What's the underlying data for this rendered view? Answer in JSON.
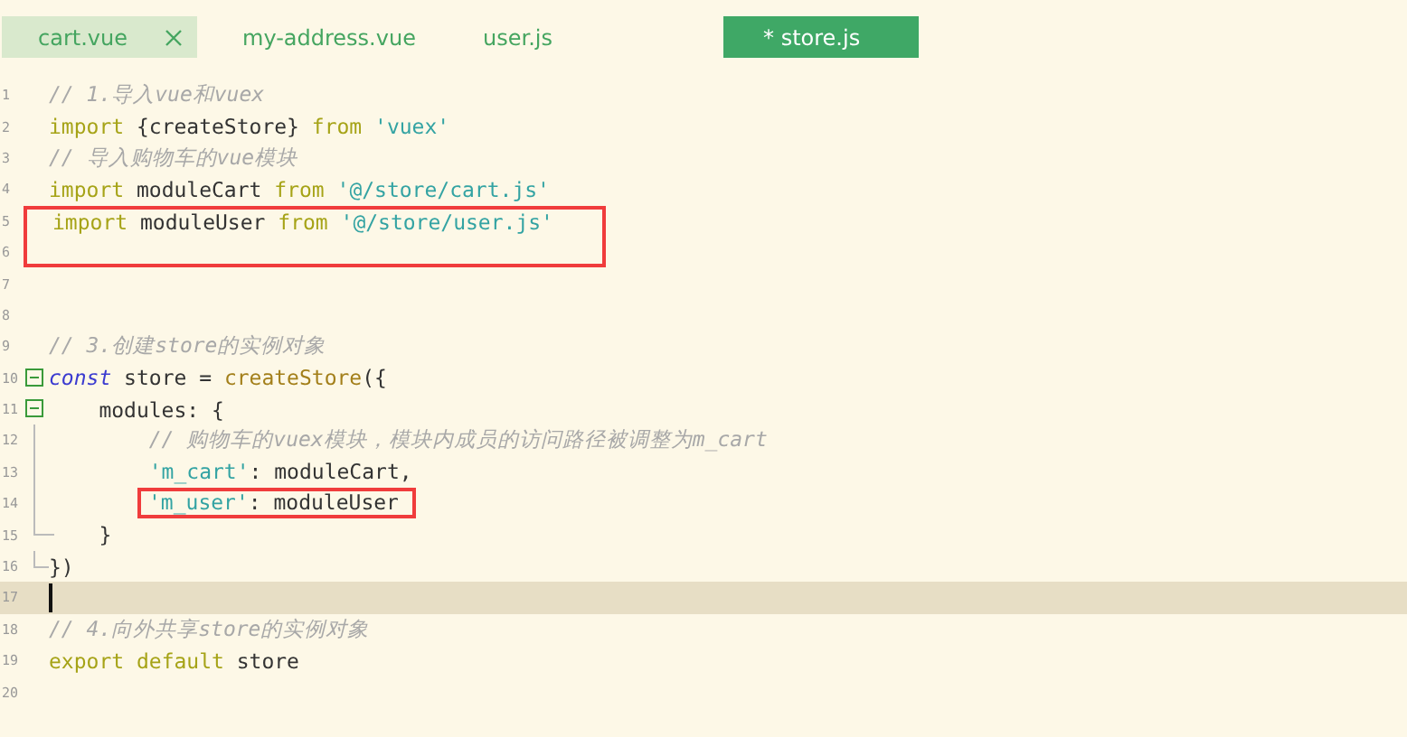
{
  "tabs": [
    {
      "label": "cart.vue",
      "selected": false,
      "hovered": true,
      "closable": true
    },
    {
      "label": "my-address.vue",
      "selected": false,
      "hovered": false,
      "closable": false
    },
    {
      "label": "user.js",
      "selected": false,
      "hovered": false,
      "closable": false
    },
    {
      "label": "* store.js",
      "selected": true,
      "hovered": false,
      "closable": false
    }
  ],
  "lines": [
    {
      "number": "1",
      "kind": "plain",
      "tokens": [
        {
          "kind": "comment",
          "text": "// 1.导入vue和vuex"
        }
      ]
    },
    {
      "number": "2",
      "kind": "plain",
      "tokens": [
        {
          "kind": "keyword",
          "text": "import"
        },
        {
          "kind": "plain",
          "text": " {createStore} "
        },
        {
          "kind": "keyword",
          "text": "from"
        },
        {
          "kind": "string",
          "text": " 'vuex'"
        }
      ]
    },
    {
      "number": "3",
      "kind": "plain",
      "tokens": [
        {
          "kind": "comment",
          "text": "// 导入购物车的vue模块"
        }
      ]
    },
    {
      "number": "4",
      "kind": "plain",
      "tokens": [
        {
          "kind": "keyword",
          "text": "import"
        },
        {
          "kind": "plain",
          "text": " moduleCart "
        },
        {
          "kind": "keyword",
          "text": "from"
        },
        {
          "kind": "string",
          "text": " '@/store/cart.js'"
        }
      ]
    },
    {
      "number": "5",
      "kind": "plain",
      "marked": true,
      "tokens": [
        {
          "kind": "keyword",
          "text": "import"
        },
        {
          "kind": "plain",
          "text": " moduleUser "
        },
        {
          "kind": "keyword",
          "text": "from"
        },
        {
          "kind": "string",
          "text": " '@/store/user.js'"
        }
      ]
    },
    {
      "number": "6",
      "kind": "plain",
      "marked": true
    },
    {
      "number": "7",
      "kind": "plain",
      "marked": false
    },
    {
      "number": "8",
      "kind": "plain"
    },
    {
      "number": "9",
      "kind": "plain",
      "tokens": [
        {
          "kind": "comment",
          "text": "// 3.创建store的实例对象"
        }
      ]
    },
    {
      "number": "10",
      "kind": "fold",
      "tokens": [
        {
          "kind": "declare",
          "text": "const"
        },
        {
          "kind": "plain",
          "text": " store = "
        },
        {
          "kind": "call",
          "text": "createStore"
        },
        {
          "kind": "plain",
          "text": "({"
        }
      ]
    },
    {
      "number": "11",
      "kind": "fold",
      "tokens": [
        {
          "kind": "plain",
          "text": "    modules: {"
        }
      ]
    },
    {
      "number": "12",
      "kind": "guide",
      "tokens": [
        {
          "kind": "comment",
          "text": "        // 购物车的vuex模块，模块内成员的访问路径被调整为m_cart"
        }
      ]
    },
    {
      "number": "13",
      "kind": "guide",
      "tokens": [
        {
          "kind": "string",
          "text": "        'm_cart'"
        },
        {
          "kind": "plain",
          "text": ": moduleCart,"
        }
      ]
    },
    {
      "number": "14",
      "kind": "guide",
      "tokens": [
        {
          "kind": "string",
          "text": "'m_user'",
          "marked": true
        },
        {
          "kind": "plain",
          "text": ": moduleUser",
          "marked": true
        }
      ]
    },
    {
      "number": "15",
      "kind": "innerend",
      "tokens": [
        {
          "kind": "plain",
          "text": "    }"
        }
      ]
    },
    {
      "number": "16",
      "kind": "end",
      "tokens": [
        {
          "kind": "plain",
          "text": "})"
        }
      ]
    },
    {
      "number": "17",
      "kind": "plain",
      "current": true
    },
    {
      "number": "18",
      "kind": "plain",
      "tokens": [
        {
          "kind": "comment",
          "text": "// 4.向外共享store的实例对象"
        }
      ]
    },
    {
      "number": "19",
      "kind": "plain",
      "tokens": [
        {
          "kind": "keyword",
          "text": "export"
        },
        {
          "kind": "keyword",
          "text": " default"
        },
        {
          "kind": "plain",
          "text": " store"
        }
      ]
    },
    {
      "number": "20",
      "kind": "plain"
    }
  ]
}
